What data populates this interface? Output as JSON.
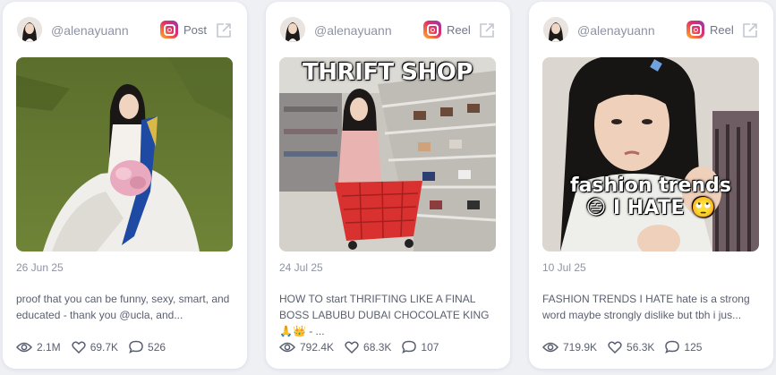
{
  "cards": [
    {
      "handle": "@alenayuann",
      "type": "Post",
      "date": "26 Jun 25",
      "caption": "proof that you can be funny, sexy, smart, and educated - thank you @ucla, and...",
      "views": "2.1M",
      "likes": "69.7K",
      "comments": "526",
      "thumbnail_text": ""
    },
    {
      "handle": "@alenayuann",
      "type": "Reel",
      "date": "24 Jul 25",
      "caption": "HOW TO start THRIFTING LIKE A FINAL BOSS LABUBU DUBAI CHOCOLATE KING 🙏👑 - ...",
      "views": "792.4K",
      "likes": "68.3K",
      "comments": "107",
      "thumbnail_text": "THRIFT SHOP"
    },
    {
      "handle": "@alenayuann",
      "type": "Reel",
      "date": "10 Jul 25",
      "caption": "FASHION TRENDS I HATE hate is a strong word maybe strongly dislike but tbh i jus...",
      "views": "719.9K",
      "likes": "56.3K",
      "comments": "125",
      "thumbnail_text_1": "fashion trends",
      "thumbnail_text_2": "😑 I HATE 🙄"
    }
  ],
  "colors": {
    "page_bg": "#eef0f4",
    "card_bg": "#ffffff",
    "muted_text": "#8e93a3",
    "body_text": "#5a5f70"
  },
  "icons": [
    "instagram-icon",
    "external-link-icon",
    "eye-icon",
    "heart-icon",
    "comment-icon"
  ]
}
